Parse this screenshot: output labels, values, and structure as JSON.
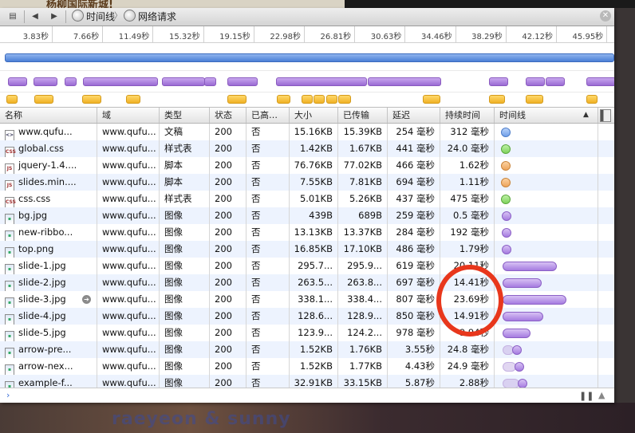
{
  "background": {
    "top_text": "杨柳国际新城!",
    "bottom_text": "raeyeon & sunny"
  },
  "toolbar": {
    "back_icon": "triangle-left-icon",
    "forward_icon": "triangle-right-icon",
    "crumbs": [
      "时间线",
      "网络请求"
    ],
    "close_icon": "close-icon"
  },
  "ruler": {
    "ticks": [
      "3.83秒",
      "7.66秒",
      "11.49秒",
      "15.32秒",
      "19.15秒",
      "22.98秒",
      "26.81秒",
      "30.63秒",
      "34.46秒",
      "38.29秒",
      "42.12秒",
      "45.95秒"
    ]
  },
  "columns": [
    "名称",
    "域",
    "类型",
    "状态",
    "已高…",
    "大小",
    "已传输",
    "延迟",
    "持续时间",
    "时间线"
  ],
  "sort_indicator": "▲",
  "rows": [
    {
      "name": "www.qufu...",
      "icon": "doc",
      "domain": "www.qufu...",
      "type": "文稿",
      "status": "200",
      "cached": "否",
      "size": "15.16KB",
      "transferred": "15.39KB",
      "latency": "254 毫秒",
      "duration": "312 毫秒",
      "bar": "blue",
      "bstart": 0,
      "lat": 0,
      "bdur": 0.45
    },
    {
      "name": "global.css",
      "icon": "css",
      "domain": "www.qufu...",
      "type": "样式表",
      "status": "200",
      "cached": "否",
      "size": "1.42KB",
      "transferred": "1.67KB",
      "latency": "441 毫秒",
      "duration": "24.0 毫秒",
      "bar": "green",
      "bstart": 0,
      "lat": 0,
      "bdur": 0.45
    },
    {
      "name": "jquery-1.4....",
      "icon": "js",
      "domain": "www.qufu...",
      "type": "脚本",
      "status": "200",
      "cached": "否",
      "size": "76.76KB",
      "transferred": "77.02KB",
      "latency": "466 毫秒",
      "duration": "1.62秒",
      "bar": "orange",
      "bstart": 0,
      "lat": 0,
      "bdur": 1.62
    },
    {
      "name": "slides.min....",
      "icon": "js",
      "domain": "www.qufu...",
      "type": "脚本",
      "status": "200",
      "cached": "否",
      "size": "7.55KB",
      "transferred": "7.81KB",
      "latency": "694 毫秒",
      "duration": "1.11秒",
      "bar": "orange",
      "bstart": 0,
      "lat": 0,
      "bdur": 1.11
    },
    {
      "name": "css.css",
      "icon": "css",
      "domain": "www.qufu...",
      "type": "样式表",
      "status": "200",
      "cached": "否",
      "size": "5.01KB",
      "transferred": "5.26KB",
      "latency": "437 毫秒",
      "duration": "475 毫秒",
      "bar": "green",
      "bstart": 0,
      "lat": 0,
      "bdur": 0.475
    },
    {
      "name": "bg.jpg",
      "icon": "img",
      "domain": "www.qufu...",
      "type": "图像",
      "status": "200",
      "cached": "否",
      "size": "439B",
      "transferred": "689B",
      "latency": "259 毫秒",
      "duration": "0.5 毫秒",
      "bar": "purple",
      "bstart": 0.3,
      "lat": 0,
      "bdur": 0.5
    },
    {
      "name": "new-ribbo...",
      "icon": "img",
      "domain": "www.qufu...",
      "type": "图像",
      "status": "200",
      "cached": "否",
      "size": "13.13KB",
      "transferred": "13.37KB",
      "latency": "284 毫秒",
      "duration": "192 毫秒",
      "bar": "purple",
      "bstart": 0.3,
      "lat": 0,
      "bdur": 0.5
    },
    {
      "name": "top.png",
      "icon": "img",
      "domain": "www.qufu...",
      "type": "图像",
      "status": "200",
      "cached": "否",
      "size": "16.85KB",
      "transferred": "17.10KB",
      "latency": "486 毫秒",
      "duration": "1.79秒",
      "bar": "purple",
      "bstart": 0.3,
      "lat": 0,
      "bdur": 1.79
    },
    {
      "name": "slide-1.jpg",
      "icon": "img",
      "domain": "www.qufu...",
      "type": "图像",
      "status": "200",
      "cached": "否",
      "size": "295.7...",
      "transferred": "295.9...",
      "latency": "619 毫秒",
      "duration": "20.11秒",
      "bar": "purple",
      "bstart": 0.5,
      "lat": 0,
      "bdur": 20.11
    },
    {
      "name": "slide-2.jpg",
      "icon": "img",
      "domain": "www.qufu...",
      "type": "图像",
      "status": "200",
      "cached": "否",
      "size": "263.5...",
      "transferred": "263.8...",
      "latency": "697 毫秒",
      "duration": "14.41秒",
      "bar": "purple",
      "bstart": 0.5,
      "lat": 0,
      "bdur": 14.41
    },
    {
      "name": "slide-3.jpg",
      "icon": "img",
      "domain": "www.qufu...",
      "type": "图像",
      "status": "200",
      "cached": "否",
      "size": "338.1...",
      "transferred": "338.4...",
      "latency": "807 毫秒",
      "duration": "23.69秒",
      "bar": "purple",
      "bstart": 0.5,
      "lat": 0,
      "bdur": 23.69,
      "goto": true
    },
    {
      "name": "slide-4.jpg",
      "icon": "img",
      "domain": "www.qufu...",
      "type": "图像",
      "status": "200",
      "cached": "否",
      "size": "128.6...",
      "transferred": "128.9...",
      "latency": "850 毫秒",
      "duration": "14.91秒",
      "bar": "purple",
      "bstart": 0.5,
      "lat": 0,
      "bdur": 14.91
    },
    {
      "name": "slide-5.jpg",
      "icon": "img",
      "domain": "www.qufu...",
      "type": "图像",
      "status": "200",
      "cached": "否",
      "size": "123.9...",
      "transferred": "124.2...",
      "latency": "978 毫秒",
      "duration": "9.94秒",
      "bar": "purple",
      "bstart": 0.6,
      "lat": 0,
      "bdur": 9.94
    },
    {
      "name": "arrow-pre...",
      "icon": "img",
      "domain": "www.qufu...",
      "type": "图像",
      "status": "200",
      "cached": "否",
      "size": "1.52KB",
      "transferred": "1.76KB",
      "latency": "3.55秒",
      "duration": "24.8 毫秒",
      "bar": "purple",
      "bstart": 0.6,
      "lat": 3.55,
      "bdur": 1.5
    },
    {
      "name": "arrow-nex...",
      "icon": "img",
      "domain": "www.qufu...",
      "type": "图像",
      "status": "200",
      "cached": "否",
      "size": "1.52KB",
      "transferred": "1.77KB",
      "latency": "4.43秒",
      "duration": "24.9 毫秒",
      "bar": "purple",
      "bstart": 0.6,
      "lat": 4.43,
      "bdur": 1.5
    },
    {
      "name": "example-f...",
      "icon": "img",
      "domain": "www.qufu...",
      "type": "图像",
      "status": "200",
      "cached": "否",
      "size": "32.91KB",
      "transferred": "33.15KB",
      "latency": "5.87秒",
      "duration": "2.88秒",
      "bar": "purple",
      "bstart": 0.6,
      "lat": 5.87,
      "bdur": 2.88
    }
  ],
  "status_bar": {
    "prompt": "›",
    "pause": "❚❚",
    "up": "▲"
  },
  "colors": {
    "document": "#6f9fe8",
    "stylesheet": "#7fd25c",
    "script": "#eea45a",
    "image": "#a67be0",
    "highlight": "#e8371c"
  }
}
